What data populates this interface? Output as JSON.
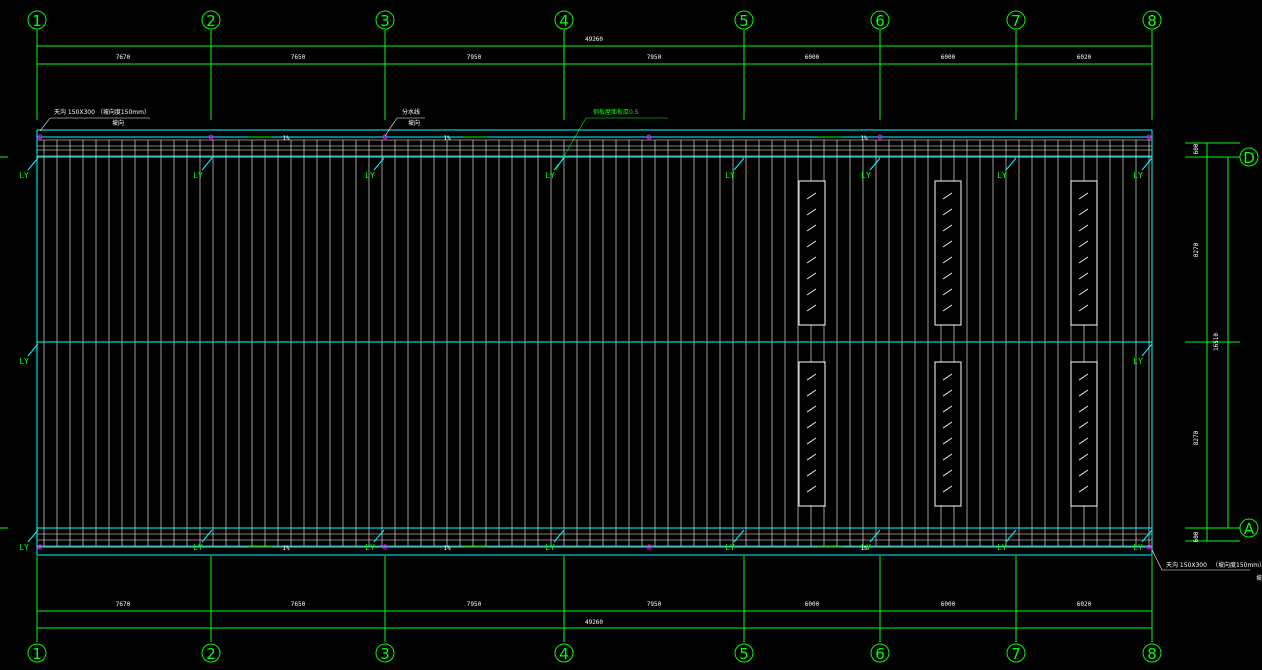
{
  "colors": {
    "background": "#000000",
    "grid_line": "#00ff00",
    "roof_outline": "#00ffff",
    "panel_line": "#ffffff",
    "marker": "#ff00ff"
  },
  "grid_axes_vertical": [
    "1",
    "2",
    "3",
    "4",
    "5",
    "6",
    "7",
    "8"
  ],
  "grid_axes_horizontal": [
    "D",
    "A"
  ],
  "dimensions_top": {
    "total": "49260",
    "spans": [
      "7670",
      "7650",
      "7950",
      "7950",
      "6000",
      "6000",
      "6020"
    ]
  },
  "dimensions_bottom": {
    "total": "49260",
    "spans": [
      "7670",
      "7650",
      "7950",
      "7950",
      "6000",
      "6000",
      "6020"
    ]
  },
  "dimensions_right": {
    "parts": [
      "600",
      "8270",
      "8270",
      "600"
    ],
    "total": "16510"
  },
  "notes": {
    "gutter_top": "天沟 150X300  （坡向度150mm）",
    "gutter_top_sub": "坡向",
    "watershed": "分水线",
    "watershed_sub": "坡向",
    "panel_note": "钢板屋面板厚0.5",
    "gutter_bottom": "天沟 150X300",
    "gutter_bottom_2": "（坡向度150mm）",
    "gutter_bottom_3": "坡向"
  },
  "slope_labels": [
    "1%",
    "1%",
    "1%",
    "1%",
    "1%",
    "1%"
  ],
  "downpipe_label": "LY",
  "downpipe_count": 18,
  "skylights": 6
}
